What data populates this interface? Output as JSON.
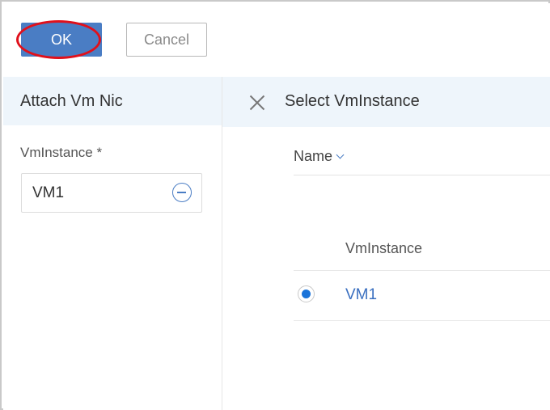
{
  "toolbar": {
    "ok_label": "OK",
    "cancel_label": "Cancel"
  },
  "left_panel": {
    "title": "Attach Vm Nic",
    "field_label": "VmInstance *",
    "field_value": "VM1"
  },
  "right_panel": {
    "title": "Select VmInstance",
    "sort_label": "Name",
    "column_header": "VmInstance",
    "rows": [
      {
        "name": "VM1",
        "selected": true
      }
    ]
  },
  "colors": {
    "accent": "#4a7dc4",
    "highlight": "#e0101b",
    "header_bg": "#eef5fb",
    "radio_selected": "#1a73d9"
  },
  "icons": [
    "minus-circle-icon",
    "close-icon",
    "chevron-down-icon"
  ]
}
